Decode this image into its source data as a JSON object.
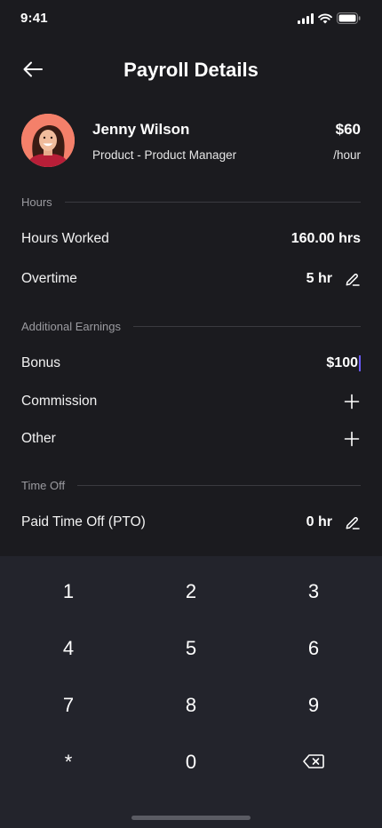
{
  "status_bar": {
    "time": "9:41"
  },
  "header": {
    "title": "Payroll Details"
  },
  "employee": {
    "name": "Jenny Wilson",
    "role": "Product - Product Manager",
    "rate": "$60",
    "rate_unit": "/hour"
  },
  "sections": {
    "hours": {
      "label": "Hours",
      "rows": [
        {
          "label": "Hours Worked",
          "value": "160.00 hrs"
        },
        {
          "label": "Overtime",
          "value": "5 hr"
        }
      ]
    },
    "earnings": {
      "label": "Additional Earnings",
      "rows": [
        {
          "label": "Bonus",
          "value": "$100"
        },
        {
          "label": "Commission"
        },
        {
          "label": "Other"
        }
      ]
    },
    "time_off": {
      "label": "Time Off",
      "rows": [
        {
          "label": "Paid Time Off (PTO)",
          "value": "0 hr"
        }
      ]
    }
  },
  "keypad": {
    "keys": [
      "1",
      "2",
      "3",
      "4",
      "5",
      "6",
      "7",
      "8",
      "9",
      "*",
      "0"
    ],
    "backspace_icon": "backspace-icon"
  },
  "colors": {
    "background": "#1b1b1f",
    "keypad_background": "#23242c",
    "cursor": "#6a5bff",
    "avatar_background": "#f4806a"
  }
}
